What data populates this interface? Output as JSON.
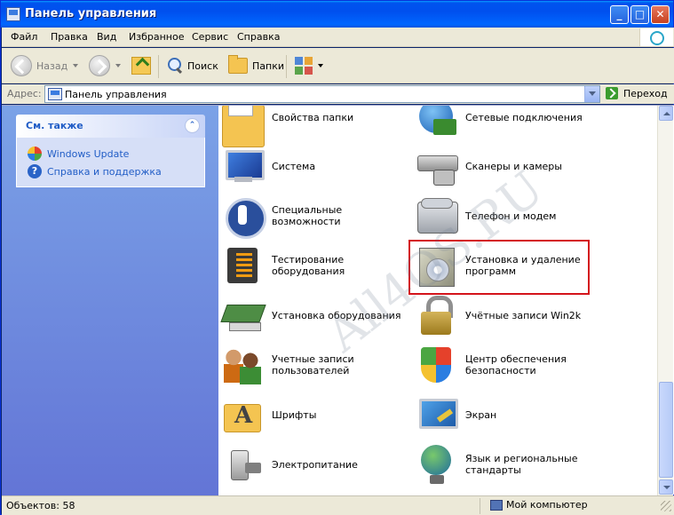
{
  "window": {
    "title": "Панель управления"
  },
  "menu": [
    "Файл",
    "Правка",
    "Вид",
    "Избранное",
    "Сервис",
    "Справка"
  ],
  "toolbar": {
    "back": "Назад",
    "search": "Поиск",
    "folders": "Папки"
  },
  "address": {
    "label": "Адрес:",
    "value": "Панель управления",
    "go": "Переход"
  },
  "taskpane": {
    "title": "См. также",
    "links": [
      "Windows Update",
      "Справка и поддержка"
    ]
  },
  "items": [
    {
      "label": "Свойства папки",
      "icon": "folder-options-icon"
    },
    {
      "label": "Сетевые подключения",
      "icon": "network-connections-icon"
    },
    {
      "label": "Система",
      "icon": "system-icon"
    },
    {
      "label": "Сканеры и камеры",
      "icon": "scanners-cameras-icon"
    },
    {
      "label": "Специальные возможности",
      "icon": "accessibility-icon"
    },
    {
      "label": "Телефон и модем",
      "icon": "phone-modem-icon"
    },
    {
      "label": "Тестирование оборудования",
      "icon": "hardware-test-icon"
    },
    {
      "label": "Установка и удаление\nпрограмм",
      "icon": "add-remove-programs-icon"
    },
    {
      "label": "Установка оборудования",
      "icon": "add-hardware-icon"
    },
    {
      "label": "Учётные записи Win2k",
      "icon": "win2k-accounts-icon"
    },
    {
      "label": "Учетные записи\nпользователей",
      "icon": "user-accounts-icon"
    },
    {
      "label": "Центр обеспечения\nбезопасности",
      "icon": "security-center-icon"
    },
    {
      "label": "Шрифты",
      "icon": "fonts-icon"
    },
    {
      "label": "Экран",
      "icon": "display-icon"
    },
    {
      "label": "Электропитание",
      "icon": "power-options-icon"
    },
    {
      "label": "Язык и региональные\nстандарты",
      "icon": "regional-options-icon"
    }
  ],
  "watermark": "All4OS.RU",
  "status": {
    "objects": "Объектов: 58",
    "location": "Мой компьютер"
  },
  "colors": {
    "titlebar": "#0053ee",
    "taskpane": "#7ba2e7",
    "highlight": "#d4141b"
  }
}
